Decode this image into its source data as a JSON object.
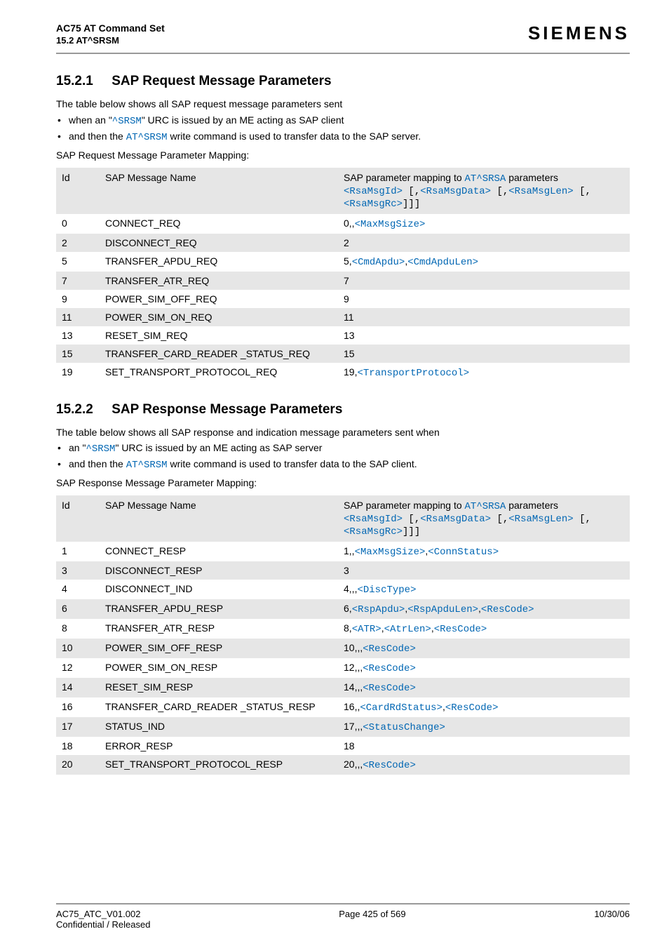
{
  "header": {
    "title": "AC75 AT Command Set",
    "subtitle": "15.2 AT^SRSM",
    "logo": "SIEMENS"
  },
  "section1": {
    "number": "15.2.1",
    "title": "SAP Request Message Parameters",
    "intro": "The table below shows all SAP request message parameters sent",
    "b1_pre": "when an \"",
    "b1_mono": "^SRSM",
    "b1_post": "\" URC is issued by an ME acting as SAP client",
    "b2_pre": "and then the ",
    "b2_mono": "AT^SRSM",
    "b2_post": " write command is used to transfer data to the SAP server.",
    "mapping": "SAP Request Message Parameter Mapping:",
    "th_id": "Id",
    "th_name": "SAP Message Name",
    "th_map_pre": "SAP parameter mapping to ",
    "th_map_cmd": "AT^SRSA",
    "th_map_post": " parameters",
    "th_map_l2a": "<RsaMsgId>",
    "th_map_l2b": " [,",
    "th_map_l2c": "<RsaMsgData>",
    "th_map_l2d": " [,",
    "th_map_l2e": "<RsaMsgLen>",
    "th_map_l2f": " [,",
    "th_map_l2g": "<RsaMsgRc>",
    "th_map_l2h": "]]]",
    "r0_id": "0",
    "r0_name": "CONNECT_REQ",
    "r0_p_pre": "0,,",
    "r0_p_m1": "<MaxMsgSize>",
    "r1_id": "2",
    "r1_name": "DISCONNECT_REQ",
    "r1_p": "2",
    "r2_id": "5",
    "r2_name": "TRANSFER_APDU_REQ",
    "r2_p_pre": "5,",
    "r2_p_m1": "<CmdApdu>",
    "r2_p_c": ",",
    "r2_p_m2": "<CmdApduLen>",
    "r3_id": "7",
    "r3_name": "TRANSFER_ATR_REQ",
    "r3_p": "7",
    "r4_id": "9",
    "r4_name": "POWER_SIM_OFF_REQ",
    "r4_p": "9",
    "r5_id": "11",
    "r5_name": "POWER_SIM_ON_REQ",
    "r5_p": "11",
    "r6_id": "13",
    "r6_name": "RESET_SIM_REQ",
    "r6_p": "13",
    "r7_id": "15",
    "r7_name": "TRANSFER_CARD_READER _STATUS_REQ",
    "r7_p": "15",
    "r8_id": "19",
    "r8_name": "SET_TRANSPORT_PROTOCOL_REQ",
    "r8_p_pre": "19,",
    "r8_p_m1": "<TransportProtocol>"
  },
  "section2": {
    "number": "15.2.2",
    "title": "SAP Response Message Parameters",
    "intro": "The table below shows all SAP response and indication message parameters sent when",
    "b1_pre": "an \"",
    "b1_mono": "^SRSM",
    "b1_post": "\" URC is issued by an ME acting as SAP server",
    "b2_pre": "and then the ",
    "b2_mono": "AT^SRSM",
    "b2_post": " write command is used to transfer data to the SAP client.",
    "mapping": "SAP Response Message Parameter Mapping:",
    "th_id": "Id",
    "th_name": "SAP Message Name",
    "th_map_pre": "SAP parameter mapping to ",
    "th_map_cmd": "AT^SRSA",
    "th_map_post": " parameters",
    "th_map_l2a": "<RsaMsgId>",
    "th_map_l2b": " [,",
    "th_map_l2c": "<RsaMsgData>",
    "th_map_l2d": " [,",
    "th_map_l2e": "<RsaMsgLen>",
    "th_map_l2f": " [,",
    "th_map_l2g": "<RsaMsgRc>",
    "th_map_l2h": "]]]",
    "r0_id": "1",
    "r0_name": "CONNECT_RESP",
    "r0_p_pre": "1,,",
    "r0_m1": "<MaxMsgSize>",
    "r0_c1": ",",
    "r0_m2": "<ConnStatus>",
    "r1_id": "3",
    "r1_name": "DISCONNECT_RESP",
    "r1_p": "3",
    "r2_id": "4",
    "r2_name": "DISCONNECT_IND",
    "r2_p_pre": "4,,,",
    "r2_m1": "<DiscType>",
    "r3_id": "6",
    "r3_name": "TRANSFER_APDU_RESP",
    "r3_p_pre": "6,",
    "r3_m1": "<RspApdu>",
    "r3_c1": ",",
    "r3_m2": "<RspApduLen>",
    "r3_c2": ",",
    "r3_m3": "<ResCode>",
    "r4_id": "8",
    "r4_name": "TRANSFER_ATR_RESP",
    "r4_p_pre": "8,",
    "r4_m1": "<ATR>",
    "r4_c1": ",",
    "r4_m2": "<AtrLen>",
    "r4_c2": ",",
    "r4_m3": "<ResCode>",
    "r5_id": "10",
    "r5_name": "POWER_SIM_OFF_RESP",
    "r5_p_pre": "10,,,",
    "r5_m1": "<ResCode>",
    "r6_id": "12",
    "r6_name": "POWER_SIM_ON_RESP",
    "r6_p_pre": "12,,,",
    "r6_m1": "<ResCode>",
    "r7_id": "14",
    "r7_name": "RESET_SIM_RESP",
    "r7_p_pre": "14,,,",
    "r7_m1": "<ResCode>",
    "r8_id": "16",
    "r8_name": "TRANSFER_CARD_READER _STATUS_RESP",
    "r8_p_pre": "16,,",
    "r8_m1": "<CardRdStatus>",
    "r8_c1": ",",
    "r8_m2": "<ResCode>",
    "r9_id": "17",
    "r9_name": "STATUS_IND",
    "r9_p_pre": "17,,,",
    "r9_m1": "<StatusChange>",
    "r10_id": "18",
    "r10_name": "ERROR_RESP",
    "r10_p": "18",
    "r11_id": "20",
    "r11_name": "SET_TRANSPORT_PROTOCOL_RESP",
    "r11_p_pre": "20,,,",
    "r11_m1": "<ResCode>"
  },
  "footer": {
    "left1": "AC75_ATC_V01.002",
    "left2": "Confidential / Released",
    "center": "Page 425 of 569",
    "right": "10/30/06"
  }
}
